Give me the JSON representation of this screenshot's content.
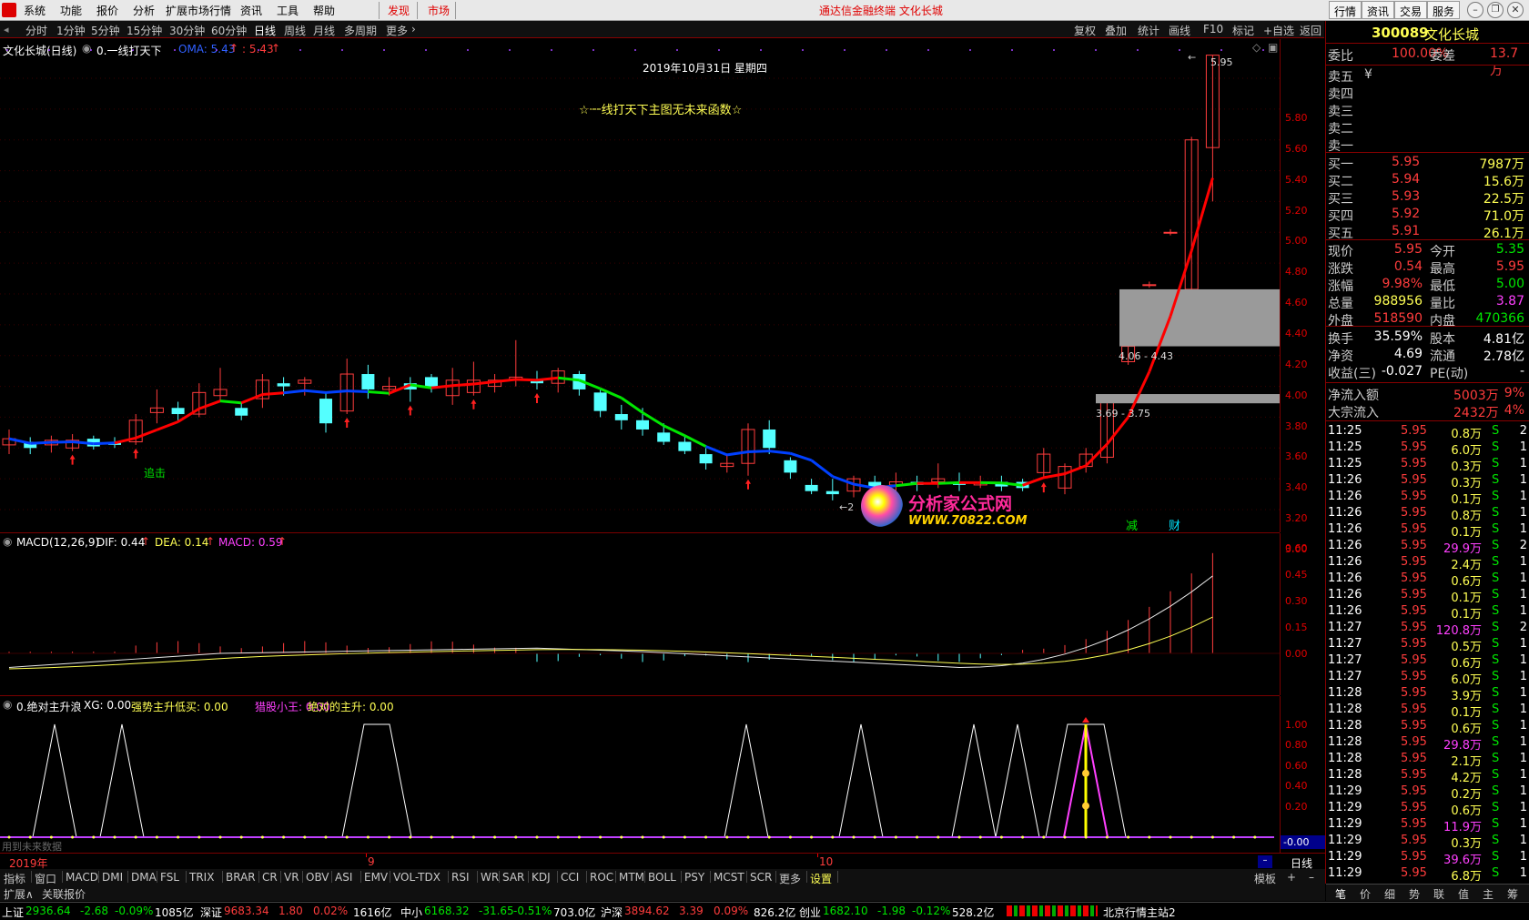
{
  "menubar": {
    "items": [
      "系统",
      "功能",
      "报价",
      "分析",
      "扩展市场行情",
      "资讯",
      "工具",
      "帮助"
    ],
    "discover": "发现",
    "market": "市场",
    "title": "通达信金融终端 文化长城",
    "right_buttons": [
      "行情",
      "资讯",
      "交易",
      "服务"
    ]
  },
  "periodbar": {
    "periods": [
      "分时",
      "1分钟",
      "5分钟",
      "15分钟",
      "30分钟",
      "60分钟",
      "日线",
      "周线",
      "月线",
      "多周期",
      "更多"
    ],
    "selected": "日线",
    "tools": [
      "复权",
      "叠加",
      "统计",
      "画线",
      "F10",
      "标记",
      "+自选",
      "返回"
    ]
  },
  "main_chart": {
    "stock_title": "文化长城(日线)",
    "indicator": "0.一线打天下",
    "oma_label": "OMA: 5.43",
    "oma_value2": ": 5.43",
    "date": "2019年10月31日 星期四",
    "banner": "☆一线打天下主图无未来函数☆",
    "label_chase": "追击",
    "label_jian": "减",
    "label_cai": "财",
    "gap1": "4.06 - 4.43",
    "gap2": "3.69 - 3.75",
    "peak_label": "5.95",
    "yticks": [
      "5.80",
      "5.60",
      "5.40",
      "5.20",
      "5.00",
      "4.80",
      "4.60",
      "4.40",
      "4.20",
      "4.00",
      "3.80",
      "3.60",
      "3.40",
      "3.20",
      "3.00"
    ]
  },
  "watermark": {
    "name": "分析家公式网",
    "url": "WWW.70822.COM"
  },
  "macd": {
    "name": "MACD(12,26,9)",
    "dif": "DIF: 0.44",
    "dea": "DEA: 0.14",
    "macd": "MACD: 0.59",
    "yticks": [
      "0.60",
      "0.45",
      "0.30",
      "0.15",
      "0.00"
    ]
  },
  "sub2": {
    "name": "0.绝对主升浪",
    "xg": "XG: 0.00",
    "f1": "强势主升低买: 0.00",
    "f2": "猎股小王: 0.00",
    "f3": "绝对的主升: 0.00",
    "yticks": [
      "1.00",
      "0.80",
      "0.60",
      "0.40",
      "0.20"
    ],
    "bottom_val": "-0.00",
    "future_note": "用到未来数据"
  },
  "xaxis": {
    "year": "2019年",
    "m9": "9",
    "m10": "10",
    "period": "日线"
  },
  "indicator_tabs": [
    "指标",
    "窗口",
    "MACD",
    "DMI",
    "DMA",
    "FSL",
    "TRIX",
    "BRAR",
    "CR",
    "VR",
    "OBV",
    "ASI",
    "EMV",
    "VOL-TDX",
    "RSI",
    "WR",
    "SAR",
    "KDJ",
    "CCI",
    "ROC",
    "MTM",
    "BOLL",
    "PSY",
    "MCST",
    "SCR",
    "更多",
    "设置"
  ],
  "tab_right": "模板",
  "bottom_tabs": [
    "扩展∧",
    "关联报价"
  ],
  "side": {
    "code": "300089",
    "name": "文化长城",
    "weibi_label": "委比",
    "weibi": "100.00%",
    "weicha_label": "委差",
    "weicha": "13.7万",
    "sells": [
      "卖五",
      "卖四",
      "卖三",
      "卖二",
      "卖一"
    ],
    "sell_currency": "¥",
    "buys": [
      {
        "label": "买一",
        "price": "5.95",
        "vol": "7987万"
      },
      {
        "label": "买二",
        "price": "5.94",
        "vol": "15.6万"
      },
      {
        "label": "买三",
        "price": "5.93",
        "vol": "22.5万"
      },
      {
        "label": "买四",
        "price": "5.92",
        "vol": "71.0万"
      },
      {
        "label": "买五",
        "price": "5.91",
        "vol": "26.1万"
      }
    ],
    "quote": [
      {
        "l1": "现价",
        "v1": "5.95",
        "l2": "今开",
        "v2": "5.35"
      },
      {
        "l1": "涨跌",
        "v1": "0.54",
        "l2": "最高",
        "v2": "5.95"
      },
      {
        "l1": "涨幅",
        "v1": "9.98%",
        "l2": "最低",
        "v2": "5.00"
      },
      {
        "l1": "总量",
        "v1": "988956",
        "l2": "量比",
        "v2": "3.87"
      },
      {
        "l1": "外盘",
        "v1": "518590",
        "l2": "内盘",
        "v2": "470366"
      }
    ],
    "quote2": [
      {
        "l1": "换手",
        "v1": "35.59%",
        "l2": "股本",
        "v2": "4.81亿"
      },
      {
        "l1": "净资",
        "v1": "4.69",
        "l2": "流通",
        "v2": "2.78亿"
      },
      {
        "l1": "收益(三)",
        "v1": "-0.027",
        "l2": "PE(动)",
        "v2": "-"
      }
    ],
    "flows": [
      {
        "l": "净流入额",
        "v": "5003万",
        "p": "9%"
      },
      {
        "l": "大宗流入",
        "v": "2432万",
        "p": "4%"
      }
    ],
    "ticks": [
      [
        "11:25",
        "5.95",
        "0.8万",
        "S",
        "2"
      ],
      [
        "11:25",
        "5.95",
        "6.0万",
        "S",
        "1"
      ],
      [
        "11:25",
        "5.95",
        "0.3万",
        "S",
        "1"
      ],
      [
        "11:26",
        "5.95",
        "0.3万",
        "S",
        "1"
      ],
      [
        "11:26",
        "5.95",
        "0.1万",
        "S",
        "1"
      ],
      [
        "11:26",
        "5.95",
        "0.8万",
        "S",
        "1"
      ],
      [
        "11:26",
        "5.95",
        "0.1万",
        "S",
        "1"
      ],
      [
        "11:26",
        "5.95",
        "29.9万",
        "S",
        "2"
      ],
      [
        "11:26",
        "5.95",
        "2.4万",
        "S",
        "1"
      ],
      [
        "11:26",
        "5.95",
        "0.6万",
        "S",
        "1"
      ],
      [
        "11:26",
        "5.95",
        "0.1万",
        "S",
        "1"
      ],
      [
        "11:26",
        "5.95",
        "0.1万",
        "S",
        "1"
      ],
      [
        "11:27",
        "5.95",
        "120.8万",
        "S",
        "2"
      ],
      [
        "11:27",
        "5.95",
        "0.5万",
        "S",
        "1"
      ],
      [
        "11:27",
        "5.95",
        "0.6万",
        "S",
        "1"
      ],
      [
        "11:27",
        "5.95",
        "6.0万",
        "S",
        "1"
      ],
      [
        "11:28",
        "5.95",
        "3.9万",
        "S",
        "1"
      ],
      [
        "11:28",
        "5.95",
        "0.1万",
        "S",
        "1"
      ],
      [
        "11:28",
        "5.95",
        "0.6万",
        "S",
        "1"
      ],
      [
        "11:28",
        "5.95",
        "29.8万",
        "S",
        "1"
      ],
      [
        "11:28",
        "5.95",
        "2.1万",
        "S",
        "1"
      ],
      [
        "11:28",
        "5.95",
        "4.2万",
        "S",
        "1"
      ],
      [
        "11:29",
        "5.95",
        "0.2万",
        "S",
        "1"
      ],
      [
        "11:29",
        "5.95",
        "0.6万",
        "S",
        "1"
      ],
      [
        "11:29",
        "5.95",
        "11.9万",
        "S",
        "1"
      ],
      [
        "11:29",
        "5.95",
        "0.3万",
        "S",
        "1"
      ],
      [
        "11:29",
        "5.95",
        "39.6万",
        "S",
        "1"
      ],
      [
        "11:29",
        "5.95",
        "6.8万",
        "S",
        "1"
      ]
    ],
    "bottom_tabs": [
      "笔",
      "价",
      "细",
      "势",
      "联",
      "值",
      "主",
      "筹"
    ]
  },
  "status": [
    {
      "name": "上证",
      "val": "2936.64",
      "chg": "-2.68",
      "pct": "-0.09%",
      "amt": "1085亿",
      "dir": "down"
    },
    {
      "name": "深证",
      "val": "9683.34",
      "chg": "1.80",
      "pct": "0.02%",
      "amt": "1616亿",
      "dir": "up"
    },
    {
      "name": "中小",
      "val": "6168.32",
      "chg": "-31.65",
      "pct": "-0.51%",
      "amt": "703.0亿",
      "dir": "down"
    },
    {
      "name": "沪深",
      "val": "3894.62",
      "chg": "3.39",
      "pct": "0.09%",
      "amt": "826.2亿",
      "dir": "up"
    },
    {
      "name": "创业",
      "val": "1682.10",
      "chg": "-1.98",
      "pct": "-0.12%",
      "amt": "528.2亿",
      "dir": "down"
    }
  ],
  "status_right": "北京行情主站2",
  "colors": {
    "up": "#ff3c3c",
    "down": "#00e600",
    "axis": "#7a0000",
    "candle_down": "#54ffff",
    "ma_up": "#ff0000",
    "ma_mid": "#0040ff",
    "ma_down": "#00e600"
  }
}
